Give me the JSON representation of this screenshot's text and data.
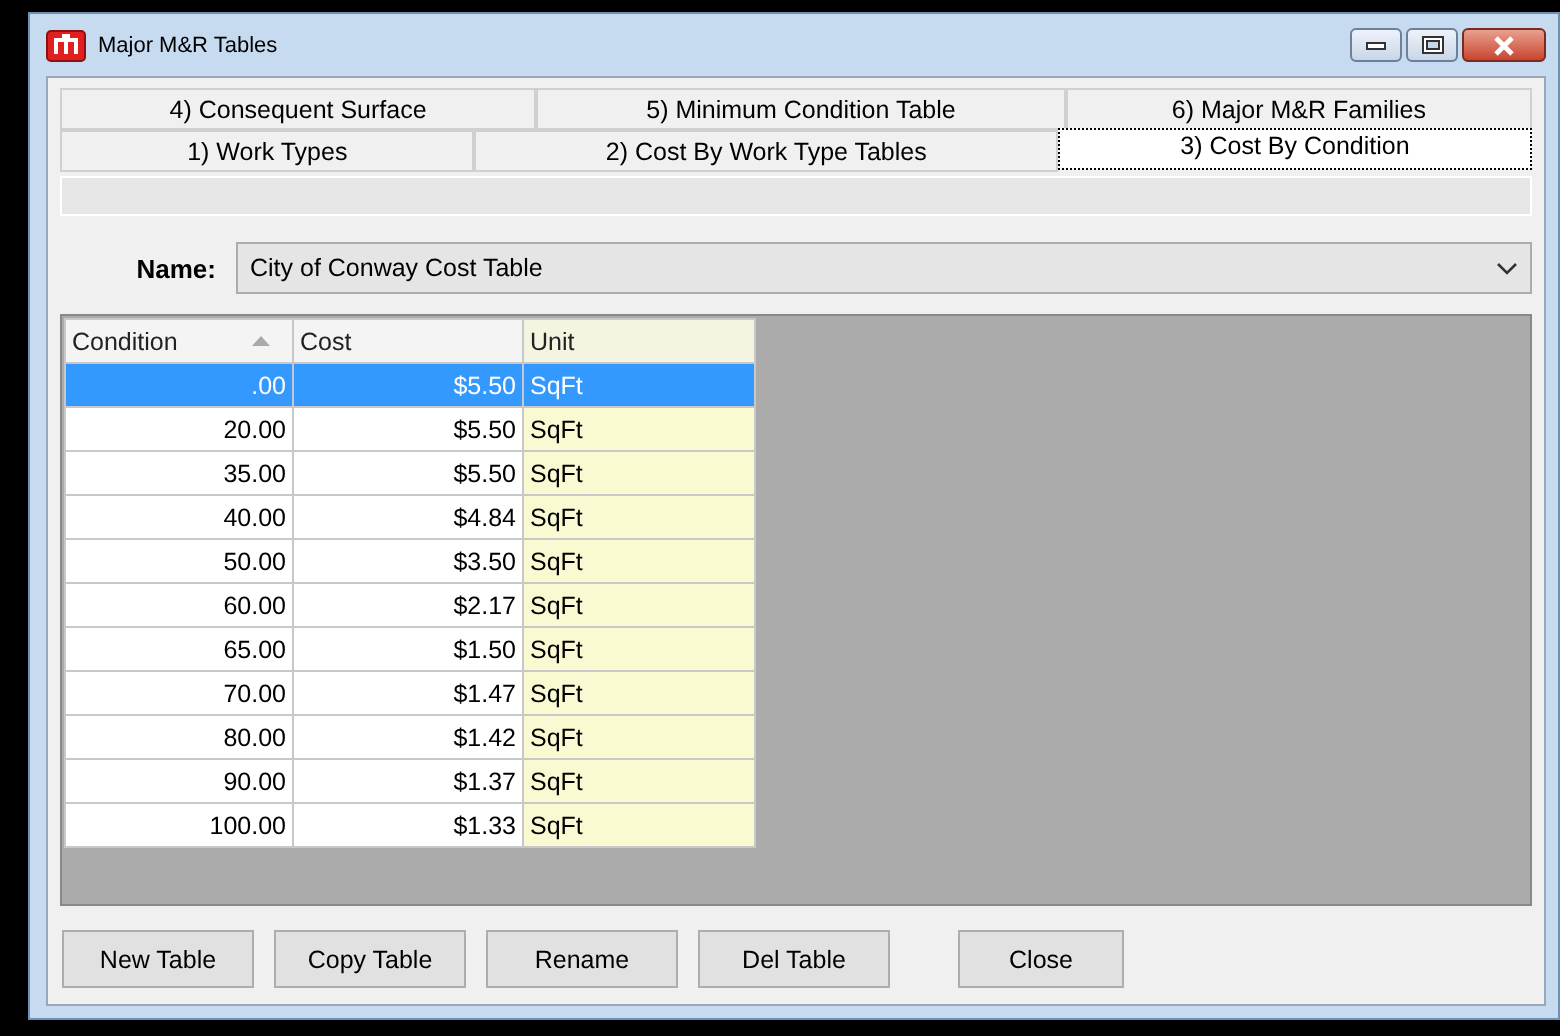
{
  "window": {
    "title": "Major M&R Tables"
  },
  "tab_rows": [
    [
      {
        "label": "4) Consequent Surface",
        "selected": false
      },
      {
        "label": "5) Minimum Condition Table",
        "selected": false
      },
      {
        "label": "6) Major M&R Families",
        "selected": false
      }
    ],
    [
      {
        "label": "1) Work Types",
        "selected": false
      },
      {
        "label": "2) Cost By Work Type Tables",
        "selected": false
      },
      {
        "label": "3) Cost By Condition",
        "selected": true
      }
    ]
  ],
  "name_field": {
    "label": "Name:",
    "value": "City of Conway Cost Table"
  },
  "table": {
    "columns": [
      {
        "label": "Condition",
        "sorted": true,
        "highlighted": false
      },
      {
        "label": "Cost",
        "sorted": false,
        "highlighted": false
      },
      {
        "label": "Unit",
        "sorted": false,
        "highlighted": true
      }
    ],
    "rows": [
      {
        "cells": [
          ".00",
          "$5.50",
          "SqFt"
        ],
        "selected": true
      },
      {
        "cells": [
          "20.00",
          "$5.50",
          "SqFt"
        ],
        "selected": false
      },
      {
        "cells": [
          "35.00",
          "$5.50",
          "SqFt"
        ],
        "selected": false
      },
      {
        "cells": [
          "40.00",
          "$4.84",
          "SqFt"
        ],
        "selected": false
      },
      {
        "cells": [
          "50.00",
          "$3.50",
          "SqFt"
        ],
        "selected": false
      },
      {
        "cells": [
          "60.00",
          "$2.17",
          "SqFt"
        ],
        "selected": false
      },
      {
        "cells": [
          "65.00",
          "$1.50",
          "SqFt"
        ],
        "selected": false
      },
      {
        "cells": [
          "70.00",
          "$1.47",
          "SqFt"
        ],
        "selected": false
      },
      {
        "cells": [
          "80.00",
          "$1.42",
          "SqFt"
        ],
        "selected": false
      },
      {
        "cells": [
          "90.00",
          "$1.37",
          "SqFt"
        ],
        "selected": false
      },
      {
        "cells": [
          "100.00",
          "$1.33",
          "SqFt"
        ],
        "selected": false
      }
    ]
  },
  "buttons": [
    "New Table",
    "Copy Table",
    "Rename",
    "Del Table",
    "Close"
  ]
}
